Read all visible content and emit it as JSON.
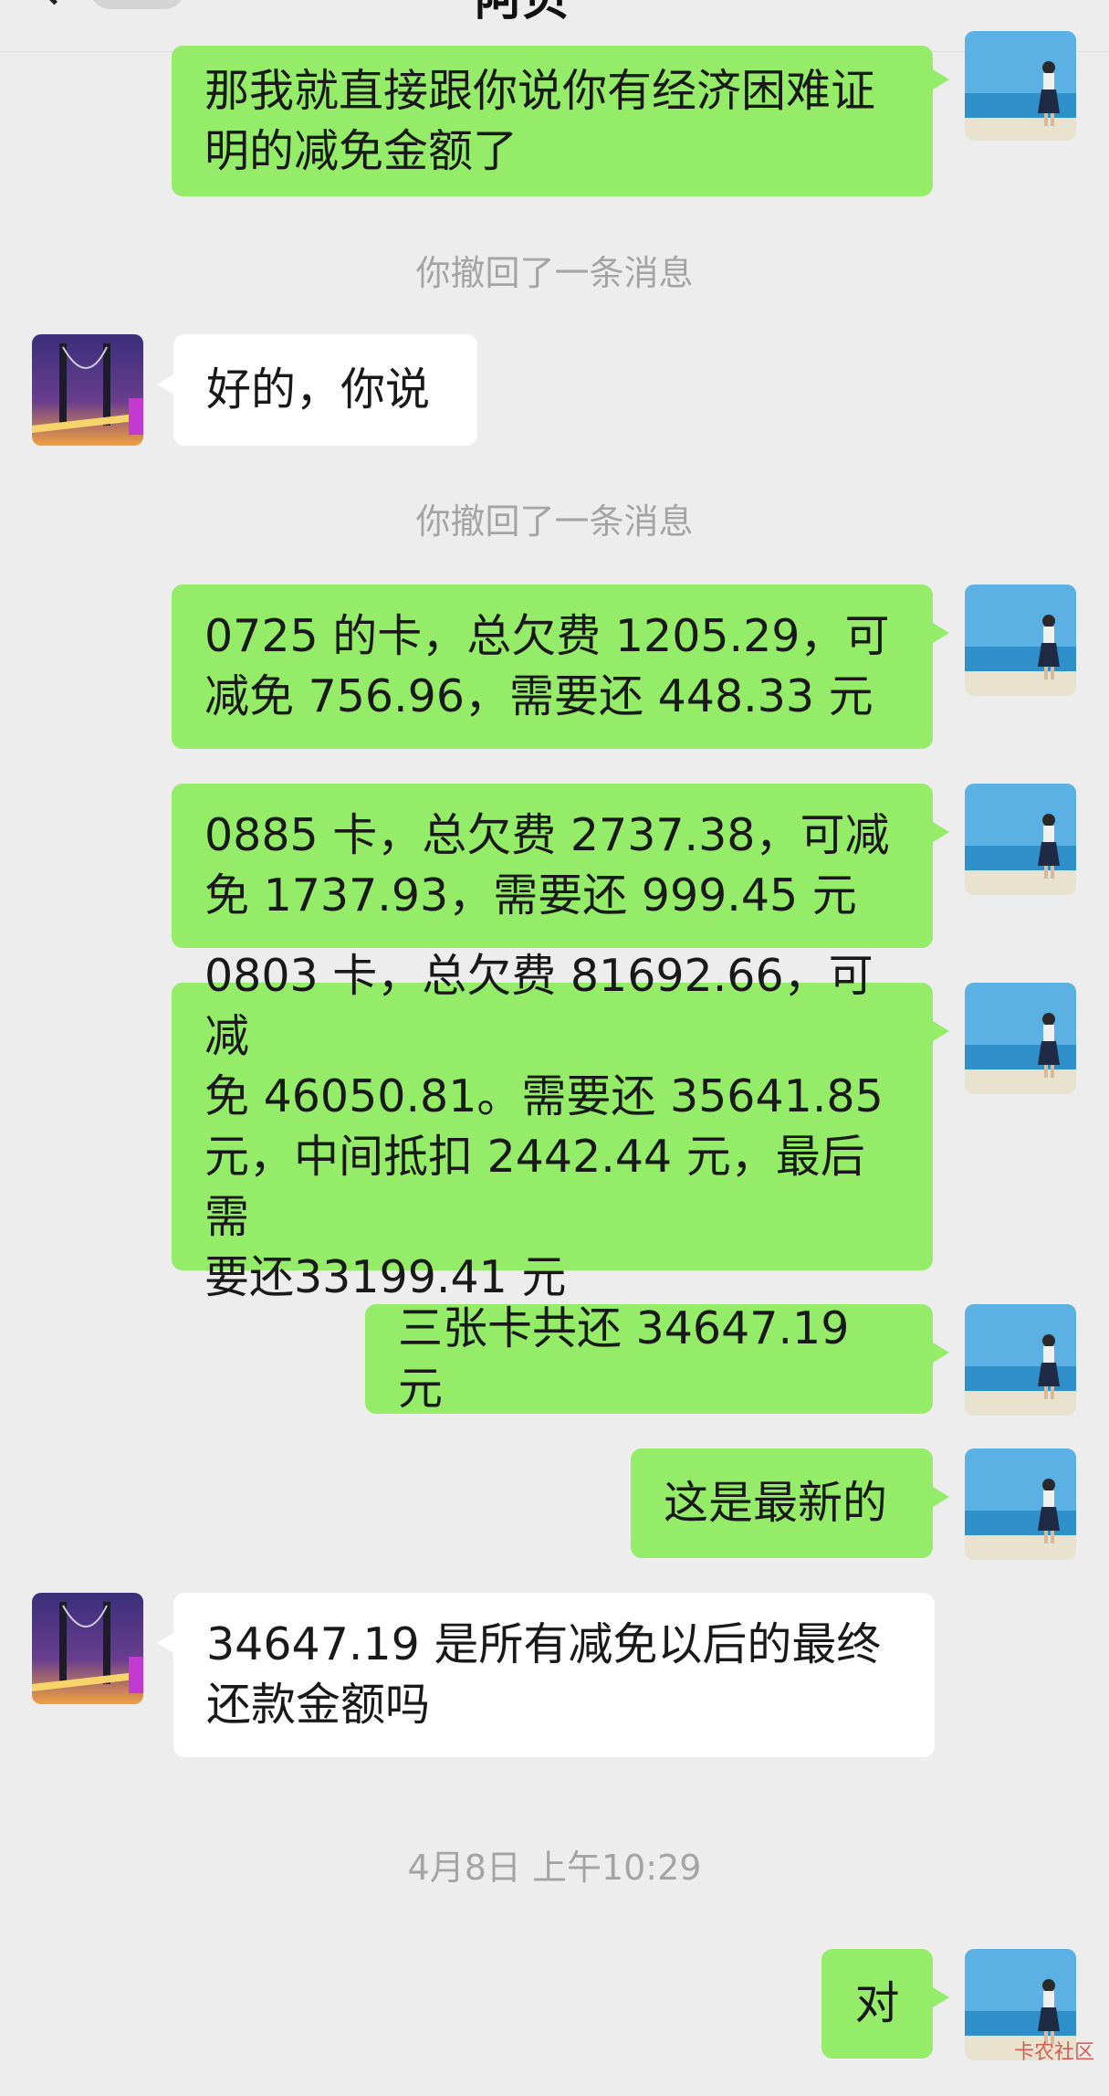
{
  "header": {
    "title": "阿贝",
    "back_label": "<"
  },
  "messages": {
    "m0": "那我就直接跟你说你有经济困难证\n明的减免金额了",
    "s1": "你撤回了一条消息",
    "m2": "好的，你说",
    "s3": "你撤回了一条消息",
    "m4": "0725 的卡，总欠费 1205.29，可\n减免 756.96，需要还 448.33 元",
    "m5": "0885 卡，总欠费 2737.38，可减\n免 1737.93，需要还 999.45 元",
    "m6": "0803 卡，总欠费 81692.66，可减\n免 46050.81。需要还 35641.85\n元，中间抵扣 2442.44 元，最后需\n要还33199.41 元",
    "m7": "三张卡共还 34647.19 元",
    "m8": "这是最新的",
    "m9": "34647.19 是所有减免以后的最终\n还款金额吗",
    "t10": "4月8日 上午10:29",
    "m11": "对"
  },
  "watermark": "卡农社区",
  "colors": {
    "outgoing_bubble": "#95ec69",
    "incoming_bubble": "#ffffff",
    "background": "#ededed",
    "system_text": "#a4a4a4"
  }
}
